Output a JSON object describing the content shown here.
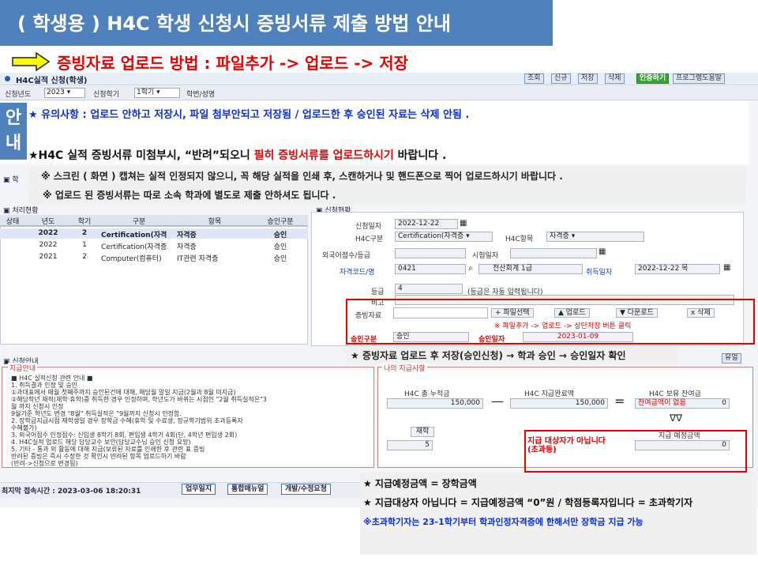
{
  "title": "( 학생용 ) H4C 학생 신청시 증빙서류 제출 방법 안내",
  "headline": "증빙자료 업로드 방법 : 파일추가 -> 업로드 -> 저장",
  "app": {
    "title": "H4C실적 신청(학생)",
    "toolbar": [
      "조회",
      "신규",
      "저장",
      "삭제",
      "인증하기",
      "프로그램도움말"
    ],
    "filters": {
      "year_label": "신청년도",
      "year_value": "2023",
      "term_label": "신청학기",
      "term_value": "1학기",
      "id_label": "학번/성명"
    }
  },
  "guide": {
    "label_top": "안",
    "label_bottom": "내"
  },
  "notices": {
    "line1": "★ 유의사항 :  업로드 안하고 저장시, 파일 첨부안되고 저장됨 / 업로드한 후 승인된 자료는 삭제 안됨 .",
    "line2_pre": "★H4C 실적 증빙서류 미첨부시, “반려”되오니 ",
    "line2_red": "필히 증빙서류를 업로드하시기",
    "line2_post": " 바랍니다 .",
    "line3": "※ 스크린 ( 화면 ) 캡쳐는 실적 인정되지 않으니, 꼭 해당 실적을 인쇄 후, 스캔하거나 및 핸드폰으로 찍어 업로드하시기 바랍니다 .",
    "line4": "※ 업로드 된 증빙서류는 따로 소속 학과에 별도로 제출 안하셔도 됩니다 ."
  },
  "sections": {
    "history": "학",
    "apply_list": "처리현황",
    "apply_info": "신청현황",
    "pay_guide": "신청안내"
  },
  "list": {
    "headers": [
      "상태",
      "년도",
      "학기",
      "구분",
      "항목",
      "승인구분"
    ],
    "rows": [
      [
        "",
        "2022",
        "2",
        "Certification(자격",
        "자격증",
        "승인"
      ],
      [
        "",
        "2022",
        "1",
        "Certification(자격증",
        "자격증",
        "승인"
      ],
      [
        "",
        "2021",
        "2",
        "Computer(컴퓨터)",
        "IT관련 자격증",
        "승인"
      ]
    ]
  },
  "form": {
    "apply_date_label": "신청일자",
    "apply_date": "2022-12-22",
    "category_label": "H4C구분",
    "category": "Certification(자격증",
    "item_label": "H4C항목",
    "item": "자격증",
    "lang_label": "외국어점수/등급",
    "exam_date_label": "시험일자",
    "cert_label": "자격코드/명",
    "cert_code": "0421",
    "cert_name": "전산회계 1급",
    "acq_date_label": "취득일자",
    "acq_date": "2022-12-22 목",
    "grade_label": "등급",
    "grade": "4",
    "grade_note": "(등급은 자동 입력됩니다)",
    "remark_label": "비고",
    "proof_label": "증빙자료",
    "file_btn": "+ 파일선택",
    "upload_btn": "▲ 업로드",
    "download_btn": "▼ 다운로드",
    "delete_btn": "x 삭제",
    "upload_note": "※ 파일추가 -> 업로드 -> 상단저장 버튼 클릭",
    "approval_label": "승인구분",
    "approval": "승인",
    "approval_date_label": "승인일자",
    "approval_date": "2023-01-09"
  },
  "approval_flow": "★ 증빙자료 업로드 후 저장(승인신청)  → 학과 승인 → 승인일자 확인",
  "pay": {
    "legend_left": "지급안내",
    "legend_right": "나의 지급사항",
    "guide_lines": [
      "■ H4C 실적신청 관련 안내 ■",
      "1. 취득결과 인정 및 승인",
      "①과대표에서 매월 첫째주까지 승인된건에 대해, 해당월 말일 지급(2월과 8월 미지급)",
      "②해당학년 재적(재학·휴학)중 취득한 경우 인정하며, 학년도가 바뀌는 시점인 \"2월 취득실적은\"3",
      "월 까지 신청시 인정",
      "9월기준 학년도 변경 \"8월\" 취득실적은 \"9월까지 신청시 인정함.",
      "2. 장학금지급시점 재학생일 경우 장학금 수혜(휴학 및 수료생, 정규학기범위 초과등록자",
      "수혜불가)",
      "3. 외국어점수 인정점수: 신입생 8학기 8회, 편입생 4학기 4회(단, 4학년 편입생 2회)",
      "4. H4C실적 업로드 해당 담당교수 보안(담당교수님 승인 신청 요망)",
      "5. 기타 - 통과 외 활동에 대해 지급(보류된 자료를 인쇄한 후 관련 표 증빙",
      "        반려된 증빙은 즉시 수정한 것 확인시 반려된 항목 업로드하기 바람",
      "        (반려->신청으로 변경됨)"
    ],
    "accum_label": "H4C 총 누적금",
    "accum_value": "150,000",
    "pay_label": "H4C 지급완료액",
    "pay_value": "150,000",
    "balance_label": "H4C 보유 잔여금",
    "balance_note": "잔여금액이 없음",
    "balance_value": "0",
    "semester_label": "재학",
    "semester_value": "5",
    "not_eligible": "지급 대상자가 아닙니다 (초과등)",
    "expected_label": "지급 예정금액",
    "expected_value": "0",
    "down_marks": "∇∇"
  },
  "status": {
    "last_login": "최지막 접속시간 : 2023-03-06 18:20:31",
    "btn1": "업무일지",
    "btn2": "통합매뉴얼",
    "btn3": "개발/수정요청"
  },
  "bottom": {
    "line1": "★ 지급예정금액 = 장학금액",
    "line2": "★ 지급대상자 아닙니다 = 지급예정금액 “0”원 / 학점등록자입니다 = 초과학기자",
    "line3": "※초과학기자는 23-1학기부터 학과인정자격증에 한해서만 장학금 지급 가능"
  },
  "colors": {
    "banner": "#4f81bd",
    "alert_red": "#e60000",
    "notice_blue": "#0b2fd6"
  }
}
